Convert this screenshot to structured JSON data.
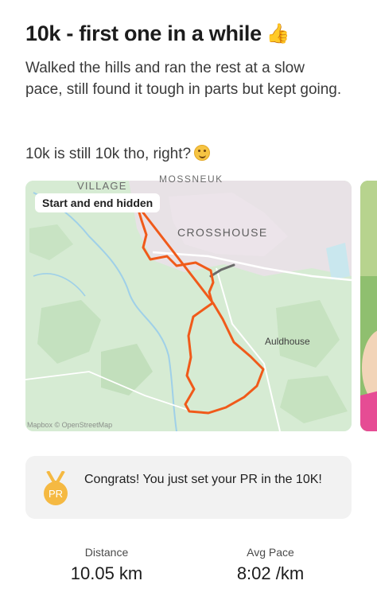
{
  "activity": {
    "title": "10k - first one in a while",
    "description": "Walked the hills and ran the rest at a slow pace, still found it tough in parts but kept going.",
    "description_2": "10k is still 10k tho, right?"
  },
  "map": {
    "privacy_badge": "Start and end hidden",
    "place_labels": {
      "village": "VILLAGE",
      "mossneuk": "MOSSNEUK",
      "crosshouse": "CROSSHOUSE",
      "auldhouse": "Auldhouse"
    },
    "attribution": "Mapbox © OpenStreetMap",
    "route_color": "#fc5200"
  },
  "achievement": {
    "medal_text": "PR",
    "message": "Congrats! You just set your PR in the 10K!",
    "medal_color": "#f5b942"
  },
  "stats": [
    {
      "label": "Distance",
      "value": "10.05 km"
    },
    {
      "label": "Avg Pace",
      "value": "8:02 /km"
    }
  ]
}
